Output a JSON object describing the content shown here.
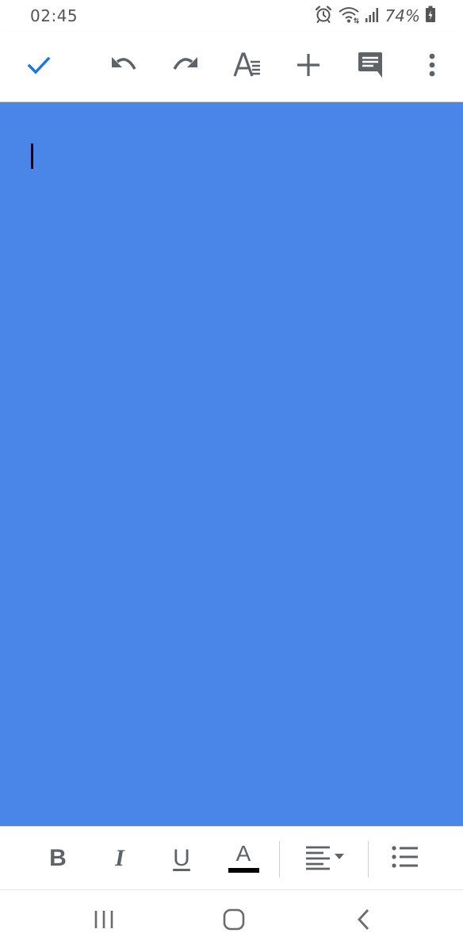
{
  "status_bar": {
    "time": "02:45",
    "battery": "74%",
    "icons": [
      "alarm-icon",
      "wifi-icon",
      "signal-icon",
      "battery-icon"
    ]
  },
  "toolbar": {
    "buttons": [
      {
        "name": "done-button",
        "icon": "checkmark-icon"
      },
      {
        "name": "undo-button",
        "icon": "undo-icon"
      },
      {
        "name": "redo-button",
        "icon": "redo-icon"
      },
      {
        "name": "text-format-button",
        "icon": "text-format-icon"
      },
      {
        "name": "insert-button",
        "icon": "plus-icon"
      },
      {
        "name": "comment-button",
        "icon": "comment-icon"
      },
      {
        "name": "more-options-button",
        "icon": "more-vert-icon"
      }
    ]
  },
  "document": {
    "content": "",
    "background_color": "#4a86e8"
  },
  "format_bar": {
    "bold_label": "B",
    "italic_label": "I",
    "underline_label": "U",
    "text_color_label": "A",
    "text_color_value": "#000000"
  },
  "colors": {
    "accent": "#1a73e8",
    "icon_gray": "#5f6368",
    "page_bg": "#4a86e8"
  }
}
